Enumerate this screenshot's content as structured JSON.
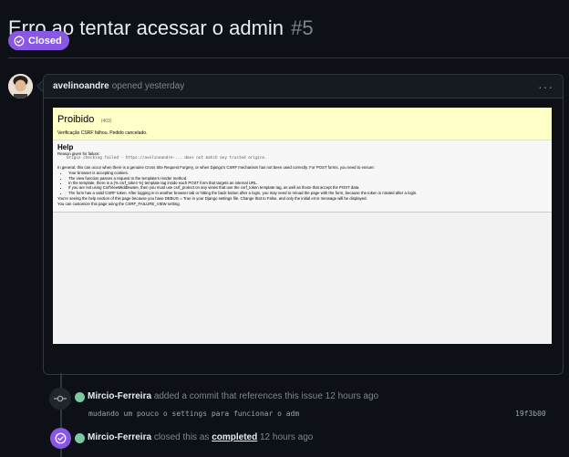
{
  "issue": {
    "title": "Erro ao tentar acessar o admin",
    "number": "#5",
    "state": "Closed",
    "state_color": "#8957e5"
  },
  "comment": {
    "author": "avelinoandre",
    "meta": "opened yesterday",
    "menu_icon": "kebab-horizontal-icon",
    "screenshot": {
      "title": "Proibido",
      "code": "(403)",
      "reason": "Verificação CSRF falhou. Pedido cancelado.",
      "help_title": "Help",
      "reason_label": "Reason given for failure:",
      "reason_value": "Origin checking failed - https://avelinoandre-... does not match any trusted origins.",
      "para1": "In general, this can occur when there is a genuine Cross Site Request Forgery, or when Django's CSRF mechanism has not been used correctly. For POST forms, you need to ensure:",
      "bullets": [
        "Your browser is accepting cookies.",
        "The view function passes a request to the template's render method.",
        "In the template, there is a {% csrf_token %} template tag inside each POST form that targets an internal URL.",
        "If you are not using CsrfViewMiddleware, then you must use csrf_protect on any views that use the csrf_token template tag, as well as those that accept the POST data.",
        "The form has a valid CSRF token. After logging in in another browser tab or hitting the back button after a login, you may need to reload the page with the form, because the token is rotated after a login."
      ],
      "para2": "You're seeing the help section of this page because you have DEBUG = True in your Django settings file. Change that to False, and only the initial error message will be displayed.",
      "para3": "You can customize this page using the CSRF_FAILURE_VIEW setting."
    }
  },
  "timeline": [
    {
      "icon": "git-commit-icon",
      "actor": "Mircio-Ferreira",
      "text": "added a commit that references this issue 12 hours ago",
      "commit_message": "mudando um pouco o settings para funcionar o adm",
      "commit_sha": "19f3b00"
    },
    {
      "icon": "issue-closed-icon",
      "actor": "Mircio-Ferreira",
      "text_before": "closed this as",
      "link": "completed",
      "text_after": "12 hours ago"
    }
  ]
}
